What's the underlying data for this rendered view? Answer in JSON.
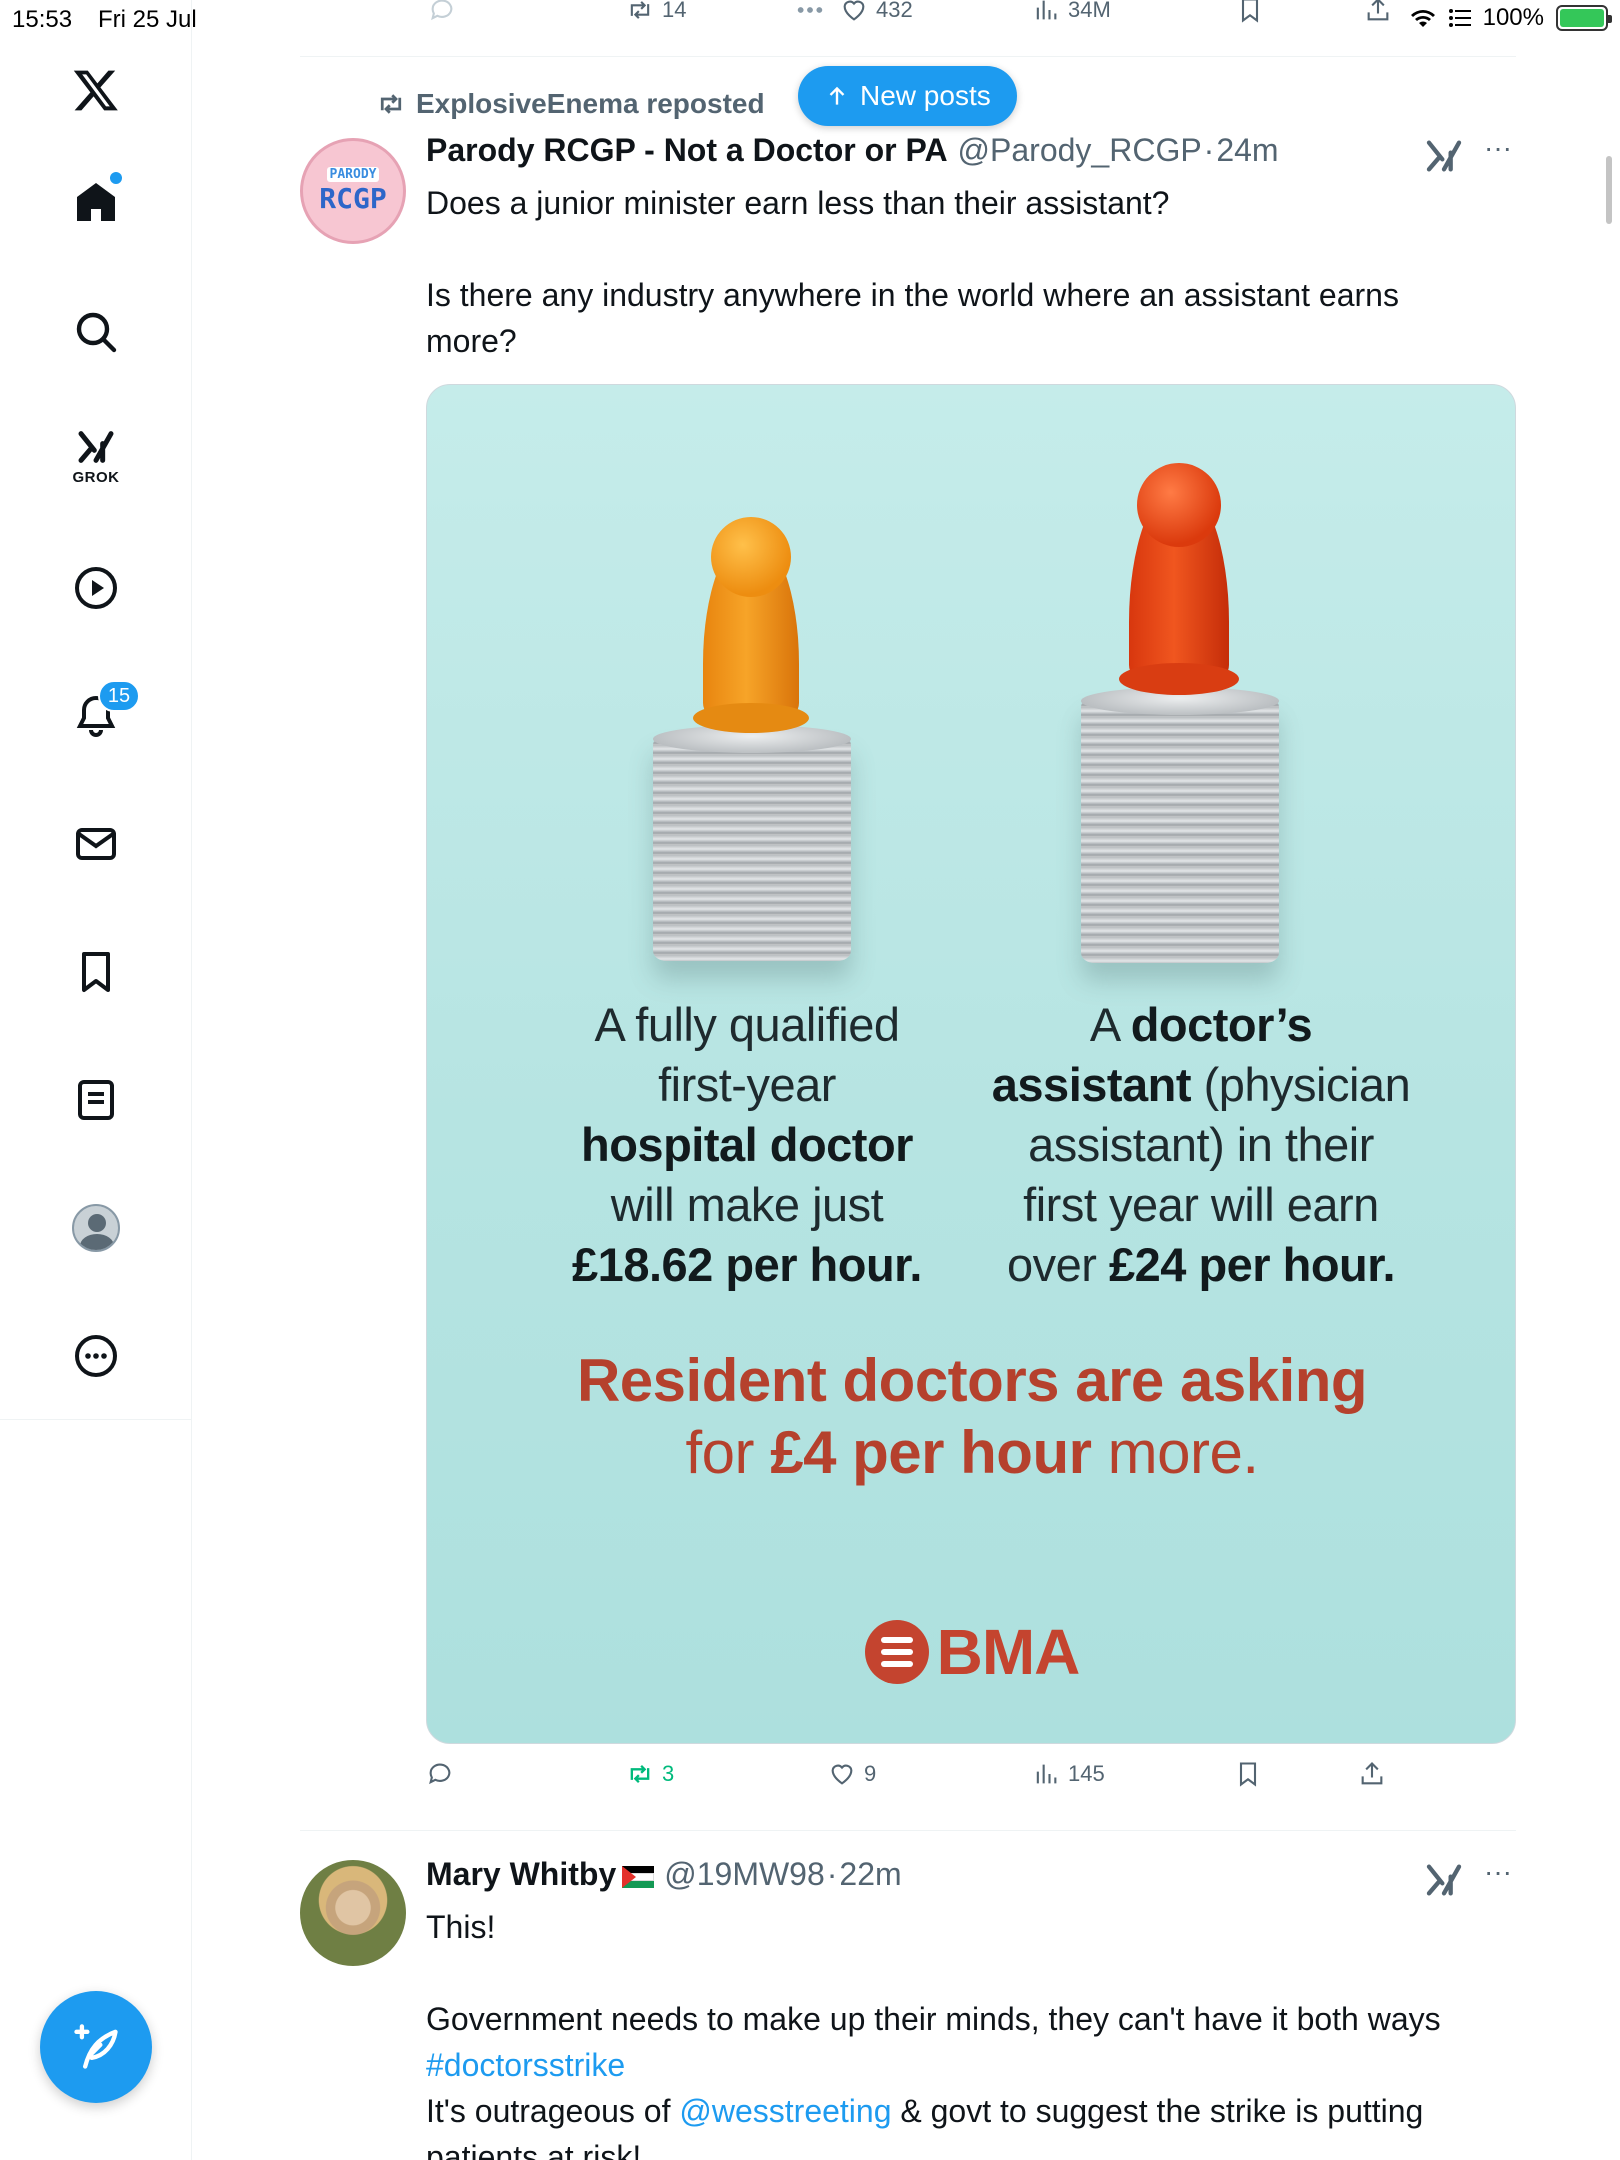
{
  "status_bar": {
    "time": "15:53",
    "date": "Fri 25 Jul",
    "battery": "100%"
  },
  "sidebar": {
    "grok_label": "GROK",
    "notifications_count": "15"
  },
  "top_actions": {
    "reposts": "14",
    "likes": "432",
    "views": "34M"
  },
  "new_posts_label": "New posts",
  "post1": {
    "reposted_by": "ExplosiveEnema reposted",
    "avatar_parody": "PARODY",
    "avatar_name": "RCGP",
    "name": "Parody RCGP - Not a Doctor or PA",
    "handle": "@Parody_RCGP",
    "separator": "·",
    "time": "24m",
    "more": "···",
    "text_line1": "Does a junior minister earn less than their assistant?",
    "text_line2": "Is there any industry anywhere in the world where an assistant earns more?",
    "media": {
      "left_1": "A fully qualified",
      "left_2": "first-year",
      "left_3": "hospital doctor",
      "left_4": "will make just",
      "left_5": "£18.62 per hour.",
      "right_1a": "A ",
      "right_1b": "doctor’s",
      "right_2a": "assistant",
      "right_2b": " (physician",
      "right_3": "assistant) in their",
      "right_4": "first year will earn",
      "right_5a": "over ",
      "right_5b": "£24 per hour.",
      "ask_1": "Resident doctors are asking",
      "ask_2a": "for ",
      "ask_2b": "£4 per hour",
      "ask_2c": " more.",
      "logo": "BMA"
    },
    "reposts": "3",
    "likes": "9",
    "views": "145"
  },
  "post2": {
    "name": "Mary Whitby",
    "handle": "@19MW98",
    "separator": "·",
    "time": "22m",
    "more": "···",
    "text_line1": "This!",
    "text_line2": "Government needs to make up their minds, they can't have it both ways",
    "hashtag": "#doctorsstrike",
    "text_line4a": "It's outrageous of ",
    "mention": "@wesstreeting",
    "text_line4b": " & govt to suggest the strike is putting",
    "text_line5": "patients at risk!"
  },
  "colors": {
    "accent": "#1d9bf0",
    "repost_green": "#00ba7c",
    "muted": "#536471",
    "bma_red": "#c4442f"
  },
  "icons": [
    "x-logo-icon",
    "home-icon",
    "search-icon",
    "grok-icon",
    "play-icon",
    "bell-icon",
    "mail-icon",
    "bookmark-icon",
    "list-icon",
    "profile-icon",
    "more-icon",
    "compose-icon",
    "reply-icon",
    "repost-icon",
    "like-icon",
    "views-icon",
    "share-icon",
    "wifi-icon",
    "battery-icon"
  ]
}
